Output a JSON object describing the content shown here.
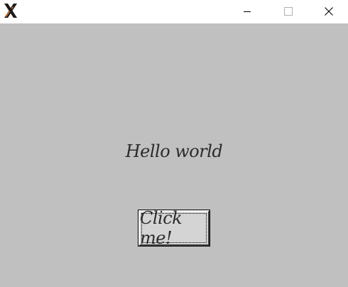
{
  "titlebar": {
    "app_icon": "x11-logo-icon",
    "controls": {
      "minimize_icon": "minimize-icon",
      "maximize_icon": "maximize-icon",
      "close_icon": "close-icon"
    }
  },
  "content": {
    "label_text": "Hello world",
    "button_label": "Click me!"
  },
  "colors": {
    "titlebar_bg": "#ffffff",
    "client_bg": "#c0c0c0",
    "button_face": "#d4d4d4",
    "text": "#2b2b2b"
  }
}
